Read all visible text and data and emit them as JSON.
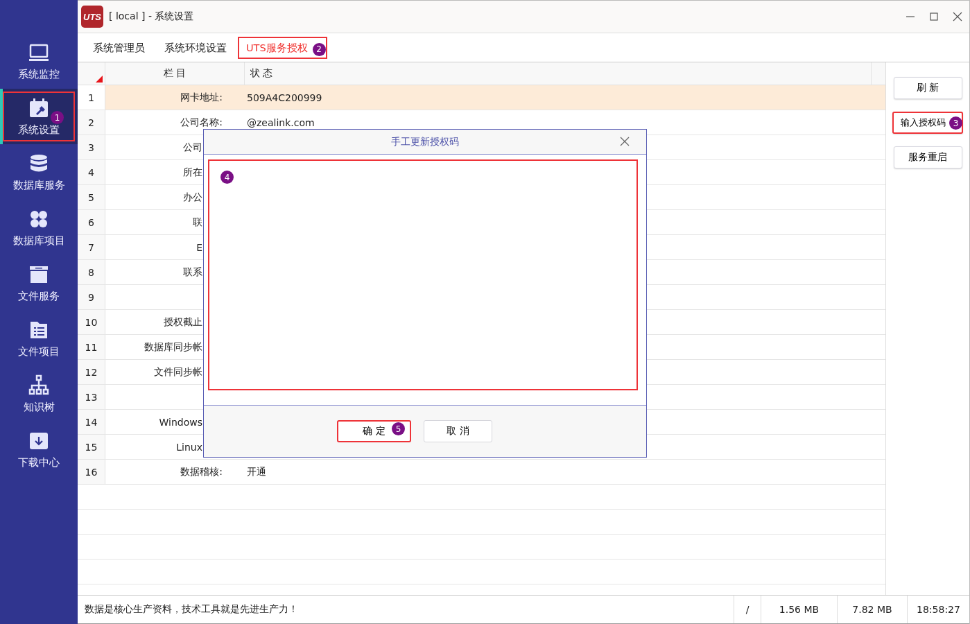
{
  "window": {
    "logo_text": "UTS",
    "title": "[ local ] - 系统设置"
  },
  "sidebar": {
    "items": [
      {
        "label": "系统监控",
        "selected": false,
        "highlighted": false
      },
      {
        "label": "系统设置",
        "selected": true,
        "highlighted": true,
        "callout": "1"
      },
      {
        "label": "数据库服务",
        "selected": false,
        "highlighted": false
      },
      {
        "label": "数据库项目",
        "selected": false,
        "highlighted": false
      },
      {
        "label": "文件服务",
        "selected": false,
        "highlighted": false
      },
      {
        "label": "文件项目",
        "selected": false,
        "highlighted": false
      },
      {
        "label": "知识树",
        "selected": false,
        "highlighted": false
      },
      {
        "label": "下载中心",
        "selected": false,
        "highlighted": false
      }
    ]
  },
  "tabs": [
    {
      "label": "系统管理员",
      "selected": false,
      "highlighted": false
    },
    {
      "label": "系统环境设置",
      "selected": false,
      "highlighted": false
    },
    {
      "label": "UTS服务授权",
      "selected": true,
      "highlighted": true,
      "callout": "2"
    }
  ],
  "table": {
    "columns": [
      "栏 目",
      "状 态"
    ],
    "rows": [
      {
        "number": "1",
        "label": "网卡地址:",
        "value": "509A4C200999",
        "selected": true,
        "covered": false
      },
      {
        "number": "2",
        "label": "公司名称:",
        "value": "@zealink.com",
        "selected": false,
        "covered": false
      },
      {
        "number": "3",
        "label": "公司",
        "selected": false,
        "covered": true
      },
      {
        "number": "4",
        "label": "所在",
        "selected": false,
        "covered": true
      },
      {
        "number": "5",
        "label": "办公",
        "selected": false,
        "covered": true
      },
      {
        "number": "6",
        "label": "联",
        "selected": false,
        "covered": true
      },
      {
        "number": "7",
        "label": "E",
        "selected": false,
        "covered": true
      },
      {
        "number": "8",
        "label": "联系",
        "selected": false,
        "covered": true
      },
      {
        "number": "9",
        "selected": false
      },
      {
        "number": "10",
        "label": "授权截止",
        "selected": false,
        "covered": true
      },
      {
        "number": "11",
        "label": "数据库同步帐",
        "selected": false,
        "covered": true
      },
      {
        "number": "12",
        "label": "文件同步帐",
        "selected": false,
        "covered": true
      },
      {
        "number": "13",
        "selected": false
      },
      {
        "number": "14",
        "label": "Windows",
        "selected": false,
        "covered": true
      },
      {
        "number": "15",
        "label": "Linux",
        "selected": false,
        "covered": true
      },
      {
        "number": "16",
        "label": "数据稽核:",
        "value": "开通",
        "selected": false,
        "covered": false
      }
    ]
  },
  "actions": [
    {
      "label": "刷 新",
      "highlighted": false
    },
    {
      "label": "输入授权码",
      "highlighted": true,
      "callout": "3"
    },
    {
      "label": "服务重启",
      "highlighted": false
    }
  ],
  "dialog": {
    "title": "手工更新授权码",
    "code_field": {
      "highlighted": true,
      "callout": "4"
    },
    "buttons": [
      {
        "label": "确 定",
        "highlighted": true,
        "callout": "5"
      },
      {
        "label": "取 消",
        "highlighted": false
      }
    ]
  },
  "status_bar": {
    "message": "数据是核心生产资料，技术工具就是先进生产力！",
    "fields": [
      "/",
      "1.56 MB",
      "7.82 MB",
      "18:58:27"
    ]
  }
}
